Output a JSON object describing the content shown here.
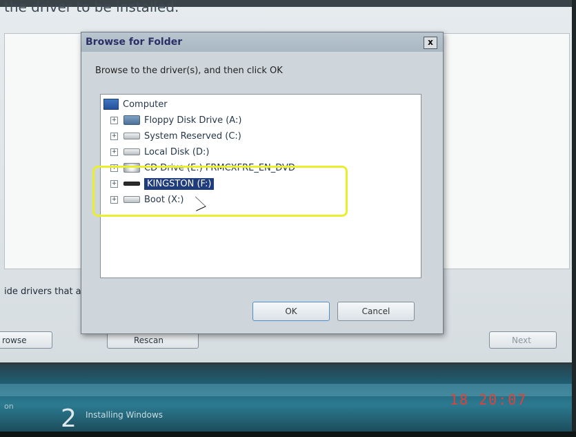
{
  "wizard": {
    "heading": "the driver to be installed.",
    "note": "ide drivers that a",
    "browse_label": "rowse",
    "rescan_label": "Rescan",
    "next_label": "Next"
  },
  "dialog": {
    "title": "Browse for Folder",
    "close_label": "x",
    "instruction": "Browse to the driver(s), and then click OK",
    "ok_label": "OK",
    "cancel_label": "Cancel"
  },
  "tree": {
    "root": "Computer",
    "expander": "+",
    "items": [
      {
        "label": "Floppy Disk Drive (A:)",
        "icon": "floppy-drive-icon"
      },
      {
        "label": "System Reserved (C:)",
        "icon": "hard-drive-icon"
      },
      {
        "label": "Local Disk (D:)",
        "icon": "hard-drive-icon"
      },
      {
        "label": "CD Drive (E:) FRMCXFRE_EN_DVD",
        "icon": "cd-drive-icon"
      },
      {
        "label": "KINGSTON (F:)",
        "icon": "usb-drive-icon",
        "selected": true
      },
      {
        "label": "Boot (X:)",
        "icon": "hard-drive-icon"
      }
    ]
  },
  "taskbar": {
    "prev_step": "on",
    "step_number": "2",
    "step_label": "Installing Windows"
  },
  "timestamp": "18  20:07",
  "colors": {
    "highlight": "#e9ef2d",
    "selection": "#1f3c7d",
    "timestamp": "#e0423a"
  }
}
